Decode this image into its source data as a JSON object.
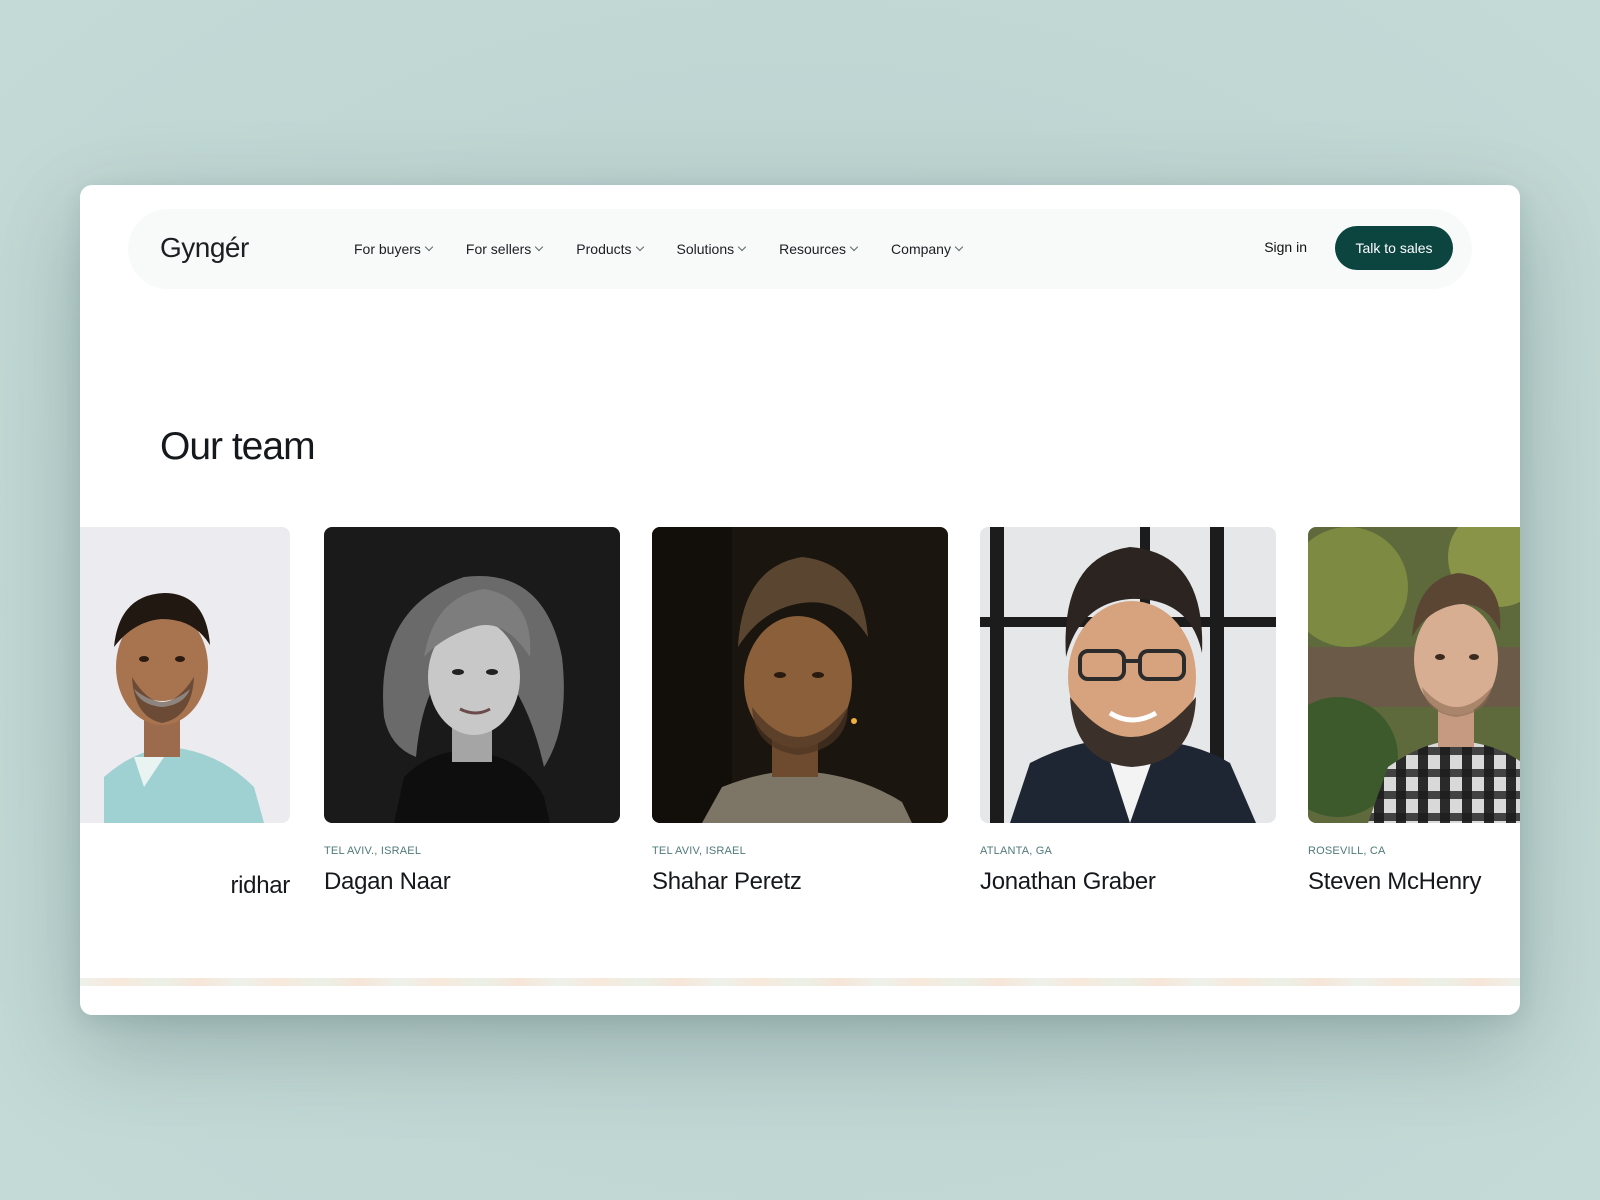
{
  "nav": {
    "logo": "Gyngér",
    "items": [
      {
        "label": "For buyers"
      },
      {
        "label": "For sellers"
      },
      {
        "label": "Products"
      },
      {
        "label": "Solutions"
      },
      {
        "label": "Resources"
      },
      {
        "label": "Company"
      }
    ],
    "sign_in": "Sign in",
    "cta": "Talk to sales"
  },
  "team": {
    "title": "Our team",
    "members": [
      {
        "name": "ridhar",
        "location": "",
        "photo_bg": "#ecebf0"
      },
      {
        "name": "Dagan Naar",
        "location": "TEL AVIV., ISRAEL",
        "photo_bg": "#1a1a1a"
      },
      {
        "name": "Shahar Peretz",
        "location": "TEL AVIV, ISRAEL",
        "photo_bg": "#1b150f"
      },
      {
        "name": "Jonathan Graber",
        "location": "ATLANTA, GA",
        "photo_bg": "#e6e7e8"
      },
      {
        "name": "Steven McHenry",
        "location": "ROSEVILL, CA",
        "photo_bg": "#5e6a3c"
      }
    ]
  },
  "colors": {
    "brand": "#0c4440",
    "accent_leaf": "#2fa06a",
    "location_text": "#4f7a79"
  }
}
